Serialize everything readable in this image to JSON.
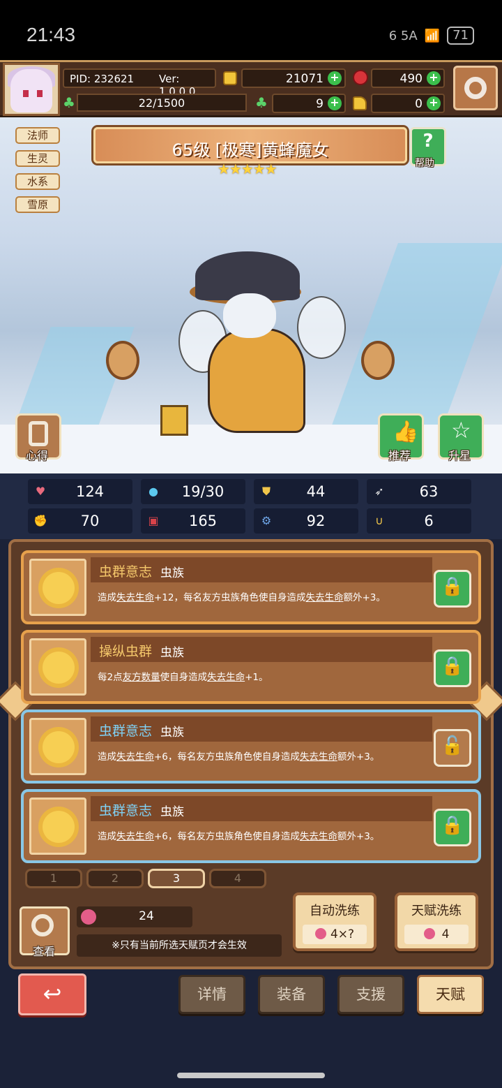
{
  "status_bar": {
    "time": "21:43",
    "network": "6 5A",
    "battery": "71"
  },
  "header": {
    "pid": "PID: 232621",
    "version": "Ver: 1.0.0.0",
    "gold": "21071",
    "gems": "490",
    "xp": "22/1500",
    "clover": "9",
    "key": "0"
  },
  "tags": [
    "法师",
    "生灵",
    "水系",
    "雪原"
  ],
  "hero": {
    "title": "65级 [极寒]黄蜂魔女",
    "stars": "★★★★★",
    "help_label": "帮助"
  },
  "side_buttons": {
    "notes": "心得",
    "recommend": "推荐",
    "star_up": "升星"
  },
  "stats": [
    {
      "icon": "heart-icon",
      "value": "124",
      "color": "#e86a7d"
    },
    {
      "icon": "mana-drop-icon",
      "value": "19/30",
      "color": "#5cc9ef"
    },
    {
      "icon": "shield-icon",
      "value": "44",
      "color": "#f1c64a"
    },
    {
      "icon": "wing-icon",
      "value": "63",
      "color": "#e6e6e6"
    },
    {
      "icon": "fist-icon",
      "value": "70",
      "color": "#e7a58c"
    },
    {
      "icon": "book-icon",
      "value": "165",
      "color": "#d8434a"
    },
    {
      "icon": "tech-icon",
      "value": "92",
      "color": "#6fa6e8"
    },
    {
      "icon": "horseshoe-icon",
      "value": "6",
      "color": "#f1c64a"
    }
  ],
  "talents": [
    {
      "name": "虫群意志",
      "race": "虫族",
      "desc_parts": [
        "造成",
        "失去生命",
        "+12，每名友方虫族角色使自身造成",
        "失去生命",
        "额外+3。"
      ],
      "locked": true
    },
    {
      "name": "操纵虫群",
      "race": "虫族",
      "desc_parts": [
        "每2点",
        "友方数量",
        "使自身造成",
        "失去生命",
        "+1。"
      ],
      "locked": true
    },
    {
      "name": "虫群意志",
      "race": "虫族",
      "desc_parts": [
        "造成",
        "失去生命",
        "+6，每名友方虫族角色使自身造成",
        "失去生命",
        "额外+3。"
      ],
      "locked": false
    },
    {
      "name": "虫群意志",
      "race": "虫族",
      "desc_parts": [
        "造成",
        "失去生命",
        "+6，每名友方虫族角色使自身造成",
        "失去生命",
        "额外+3。"
      ],
      "locked": true
    }
  ],
  "page_tabs": [
    "1",
    "2",
    "3",
    "4"
  ],
  "active_page": 2,
  "bottom_panel": {
    "view_label": "查看",
    "fruit_count": "24",
    "note": "※只有当前所选天赋页才会生效",
    "auto_refine": {
      "label": "自动洗练",
      "cost": "4×?"
    },
    "talent_refine": {
      "label": "天赋洗练",
      "cost": "4"
    }
  },
  "nav": {
    "back": "↩",
    "details": "详情",
    "equipment": "装备",
    "support": "支援",
    "talent": "天赋"
  }
}
